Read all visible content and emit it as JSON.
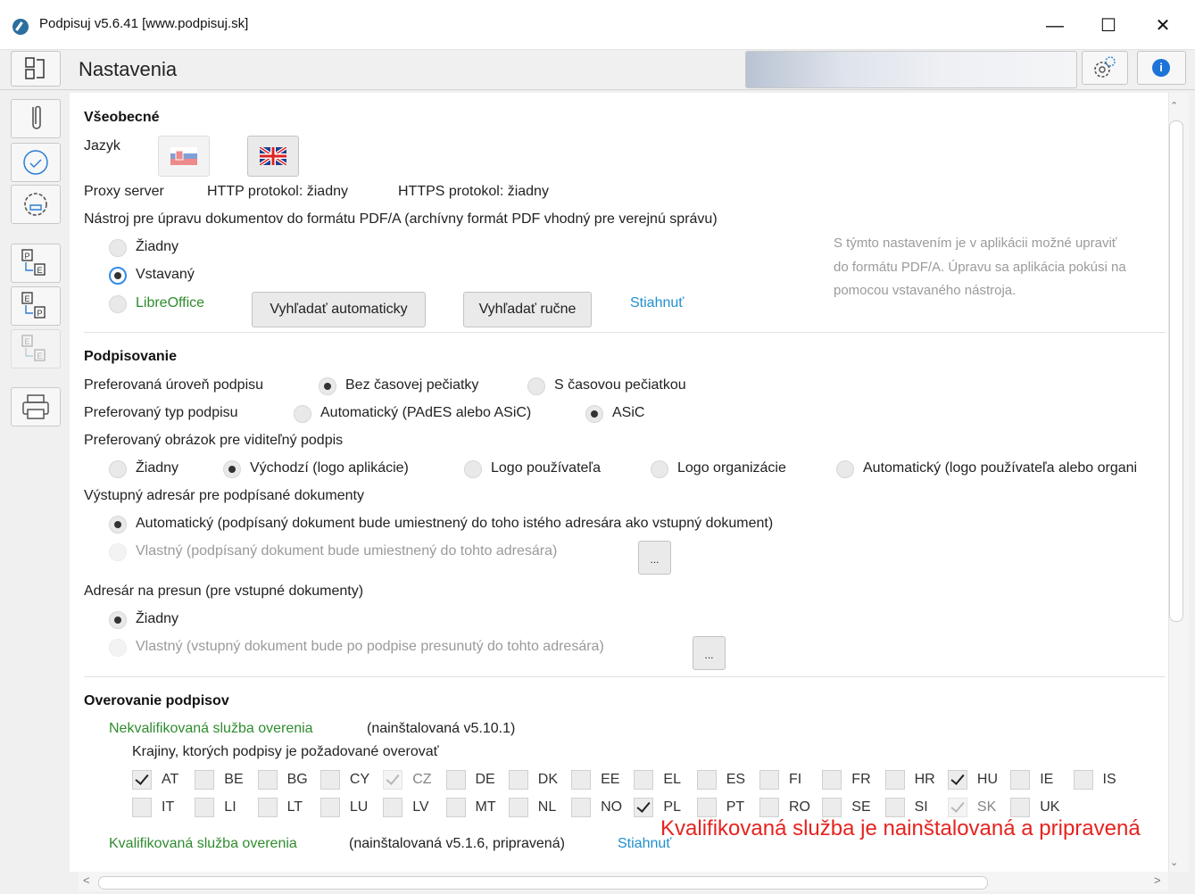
{
  "window": {
    "title": "Podpisuj v5.6.41 [www.podpisuj.sk]"
  },
  "header": {
    "title": "Nastavenia"
  },
  "general": {
    "heading": "Všeobecné",
    "language_label": "Jazyk",
    "proxy_label": "Proxy server",
    "http": "HTTP protokol: žiadny",
    "https": "HTTPS protokol: žiadny",
    "pdfa_label": "Nástroj pre úpravu dokumentov do formátu PDF/A (archívny formát PDF vhodný pre verejnú správu)",
    "pdfa_options": [
      "Žiadny",
      "Vstavaný",
      "LibreOffice"
    ],
    "btn_auto": "Vyhľadať automaticky",
    "btn_manual": "Vyhľadať ručne",
    "download": "Stiahnuť",
    "hint_lines": [
      "S týmto nastavením je v aplikácii možné upraviť",
      "do formátu PDF/A. Úpravu sa aplikácia pokúsi na",
      "pomocou vstavaného nástroja."
    ]
  },
  "signing": {
    "heading": "Podpisovanie",
    "level_label": "Preferovaná úroveň podpisu",
    "level_options": [
      "Bez časovej pečiatky",
      "S časovou pečiatkou"
    ],
    "type_label": "Preferovaný typ podpisu",
    "type_options": [
      "Automatický (PAdES alebo ASiC)",
      "ASiC"
    ],
    "image_label": "Preferovaný obrázok pre viditeľný podpis",
    "image_options": [
      "Žiadny",
      "Východzí (logo aplikácie)",
      "Logo používateľa",
      "Logo organizácie",
      "Automatický (logo používateľa alebo organi"
    ],
    "output_label": "Výstupný adresár pre podpísané dokumenty",
    "output_auto": "Automatický (podpísaný dokument bude umiestnený do toho istého adresára ako vstupný dokument)",
    "output_custom": "Vlastný (podpísaný dokument bude umiestnený do tohto adresára)",
    "browse": "...",
    "move_label": "Adresár na presun (pre vstupné dokumenty)",
    "move_none": "Žiadny",
    "move_custom": "Vlastný (vstupný dokument bude po podpise presunutý do tohto adresára)"
  },
  "verify": {
    "heading": "Overovanie podpisov",
    "nq_service": "Nekvalifikovaná služba overenia",
    "nq_status": "(nainštalovaná v5.10.1)",
    "countries_label": "Krajiny, ktorých podpisy je požadované overovať",
    "countries_row1": [
      "AT",
      "BE",
      "BG",
      "CY",
      "CZ",
      "DE",
      "DK",
      "EE",
      "EL",
      "ES",
      "FI",
      "FR",
      "HR",
      "HU",
      "IE",
      "IS"
    ],
    "countries_row2": [
      "IT",
      "LI",
      "LT",
      "LU",
      "LV",
      "MT",
      "NL",
      "NO",
      "PL",
      "PT",
      "RO",
      "SE",
      "SI",
      "SK",
      "UK"
    ],
    "q_service": "Kvalifikovaná služba overenia",
    "q_status": "(nainštalovaná v5.1.6, pripravená)",
    "download": "Stiahnuť"
  },
  "annotation": "Kvalifikovaná služba je nainštalovaná a pripravená",
  "colors": {
    "accent": "#2f8be6",
    "green": "#2f8c2f",
    "link": "#1f8fcf",
    "annotation": "#e5231f"
  }
}
